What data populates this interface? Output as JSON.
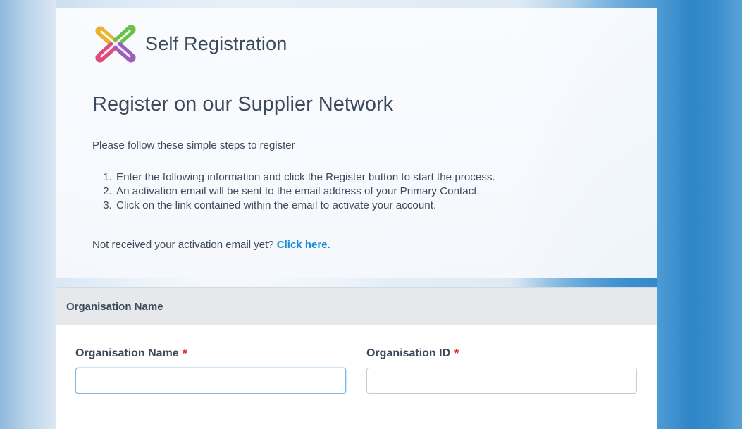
{
  "app": {
    "title": "Self Registration"
  },
  "page": {
    "heading": "Register on our Supplier Network",
    "intro": "Please follow these simple steps to register",
    "steps": [
      "Enter the following information and click the Register button to start the process.",
      "An activation email will be sent to the email address of your Primary Contact.",
      "Click on the link contained within the email to activate your account."
    ],
    "notice_text": "Not received your activation email yet?",
    "notice_link": "Click here."
  },
  "form": {
    "section_title": "Organisation Name",
    "fields": [
      {
        "label": "Organisation Name",
        "required_mark": "*",
        "value": "",
        "placeholder": "",
        "focused": true
      },
      {
        "label": "Organisation ID",
        "required_mark": "*",
        "value": "",
        "placeholder": "",
        "focused": false
      }
    ]
  },
  "colors": {
    "text": "#3d4a5c",
    "link": "#1a8fd8",
    "required": "#e0272c",
    "section_header_bg": "#e6e8ec",
    "focus_border": "#7db8e8"
  },
  "icons": {
    "logo": "self-registration-logo-icon"
  }
}
